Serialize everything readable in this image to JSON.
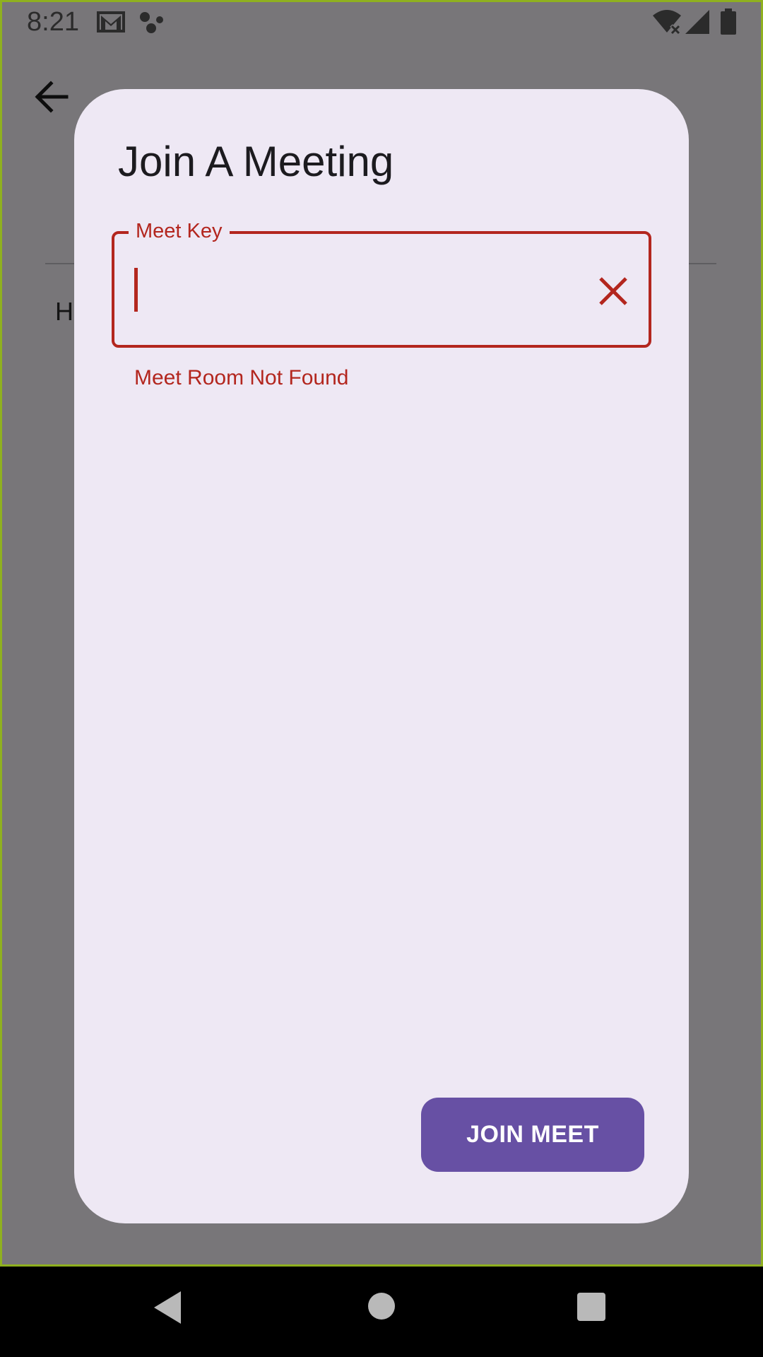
{
  "status_bar": {
    "time": "8:21",
    "icons": [
      "gmail-icon",
      "assistant-dots-icon",
      "wifi-icon",
      "signal-icon",
      "battery-icon"
    ]
  },
  "background": {
    "back_icon": "arrow-left-icon",
    "partial_text": "H"
  },
  "dialog": {
    "title": "Join A Meeting",
    "field": {
      "label": "Meet Key",
      "value": "",
      "placeholder": "",
      "error": "Meet Room Not Found",
      "clear_icon": "close-icon"
    },
    "join_button_label": "JOIN MEET"
  },
  "nav_bar": {
    "icons": [
      "back-triangle-icon",
      "home-circle-icon",
      "recents-square-icon"
    ]
  },
  "colors": {
    "scrim": "#787679",
    "dialog_background": "#eee8f4",
    "error": "#b3261e",
    "primary": "#6750a4",
    "on_primary": "#ffffff",
    "title_text": "#1c1b1f"
  }
}
